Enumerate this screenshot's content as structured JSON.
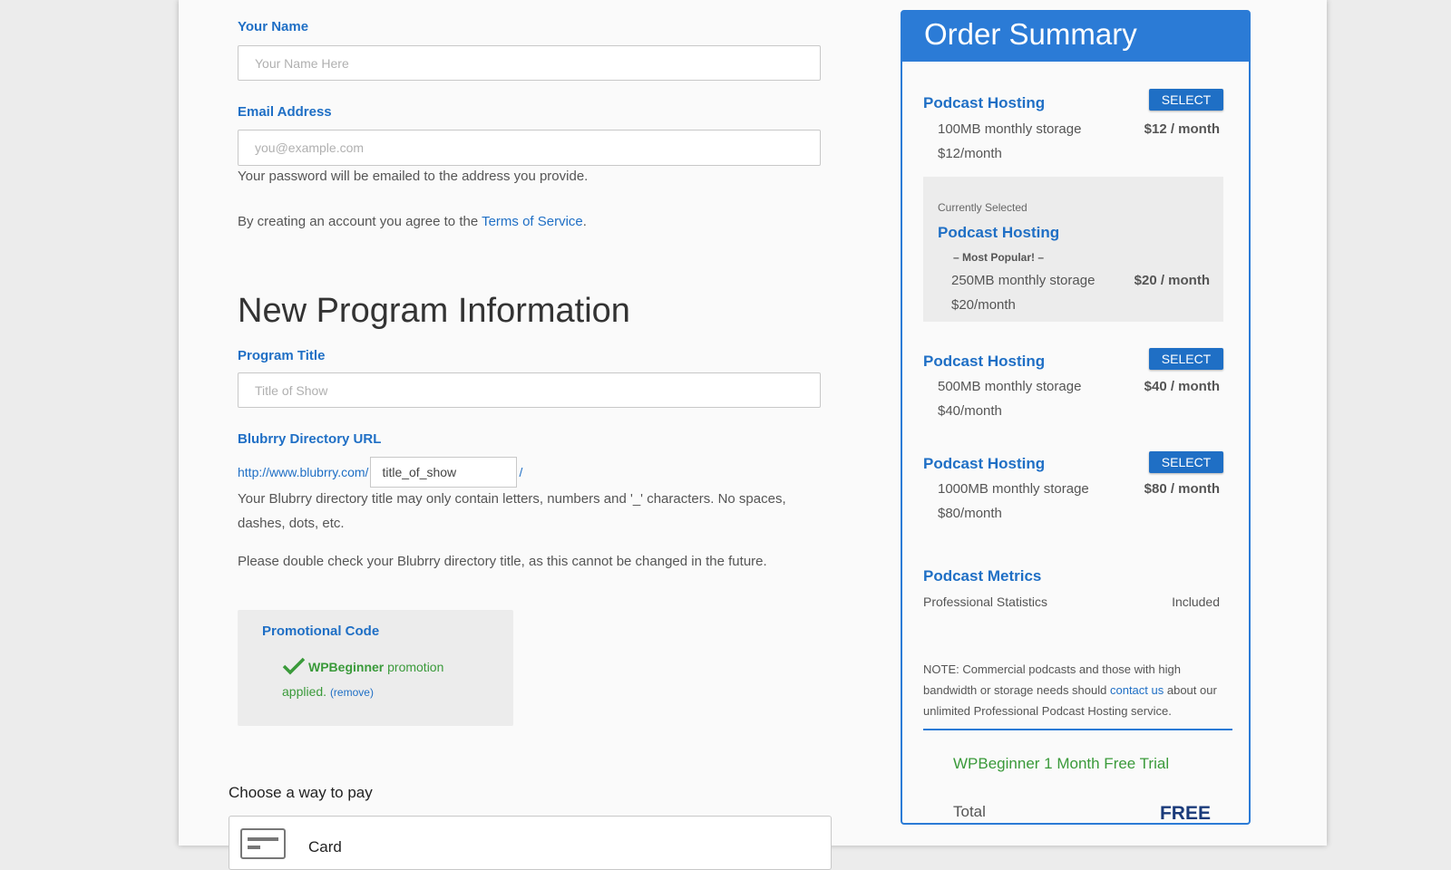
{
  "account": {
    "name_label": "Your Name",
    "name_placeholder": "Your Name Here",
    "email_label": "Email Address",
    "email_placeholder": "you@example.com",
    "email_help": "Your password will be emailed to the address you provide.",
    "terms_prefix": "By creating an account you agree to the ",
    "terms_link": "Terms of Service",
    "terms_suffix": "."
  },
  "program": {
    "heading": "New Program Information",
    "title_label": "Program Title",
    "title_placeholder": "Title of Show",
    "url_label": "Blubrry Directory URL",
    "url_prefix": "http://www.blubrry.com/",
    "url_value": "title_of_show",
    "url_suffix": "/",
    "url_help": "Your Blubrry directory title may only contain letters, numbers and '_' characters. No spaces, dashes, dots, etc.",
    "url_warning": "Please double check your Blubrry directory title, as this cannot be changed in the future."
  },
  "promo": {
    "title": "Promotional Code",
    "code": "WPBeginner",
    "text": " promotion applied.",
    "remove": "(remove)"
  },
  "payment": {
    "heading": "Choose a way to pay",
    "card_label": "Card"
  },
  "summary": {
    "title": "Order Summary",
    "select_label": "SELECT",
    "plans": [
      {
        "name": "Podcast Hosting",
        "storage": "100MB monthly storage",
        "sub": "$12/month",
        "price": "$12 / month"
      },
      {
        "name": "Podcast Hosting",
        "storage": "250MB monthly storage",
        "sub": "$20/month",
        "price": "$20 / month",
        "badge": "– Most Popular! –",
        "current": "Currently Selected"
      },
      {
        "name": "Podcast Hosting",
        "storage": "500MB monthly storage",
        "sub": "$40/month",
        "price": "$40 / month"
      },
      {
        "name": "Podcast Hosting",
        "storage": "1000MB monthly storage",
        "sub": "$80/month",
        "price": "$80 / month"
      }
    ],
    "metrics": {
      "name": "Podcast Metrics",
      "desc": "Professional Statistics",
      "value": "Included"
    },
    "note_prefix": "NOTE: Commercial podcasts and those with high bandwidth or storage needs should ",
    "note_link": "contact us",
    "note_suffix": " about our unlimited Professional Podcast Hosting service.",
    "trial": "WPBeginner 1 Month Free Trial",
    "total_label": "Total",
    "total_value": "FREE"
  },
  "colors": {
    "accent": "#2b7bd6",
    "link": "#1f6fc5",
    "success": "#3a9a3a",
    "total": "#1a3a7a"
  }
}
